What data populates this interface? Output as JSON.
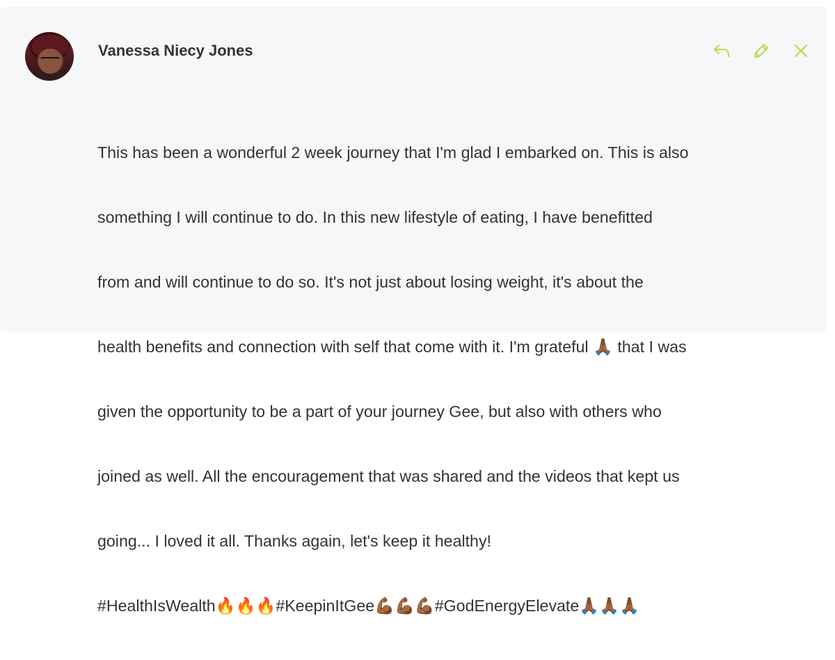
{
  "post": {
    "author_name": "Vanessa Niecy Jones",
    "body_lines": [
      "This has been a wonderful 2 week journey that I'm glad I embarked on. This is also",
      "something I will continue to do. In this new lifestyle of eating, I have benefitted",
      "from and will continue to do so. It's not just about losing weight, it's about the",
      "health benefits and connection with self that come with it. I'm grateful 🙏🏾 that I was",
      "given the opportunity to be a part of your journey Gee, but also with others who",
      "joined as well. All the encouragement that was shared and the videos that kept us",
      "going... I loved it all. Thanks again, let's keep it healthy!",
      "#HealthIsWealth🔥🔥🔥#KeepinItGee💪🏾💪🏾💪🏾#GodEnergyElevate🙏🏾🙏🏾🙏🏾"
    ]
  },
  "actions": {
    "reply_icon": "reply-icon",
    "edit_icon": "pencil-icon",
    "close_icon": "close-icon"
  },
  "colors": {
    "accent": "#b8d94a",
    "card_background": "#f6f7f9",
    "text": "#333333"
  }
}
